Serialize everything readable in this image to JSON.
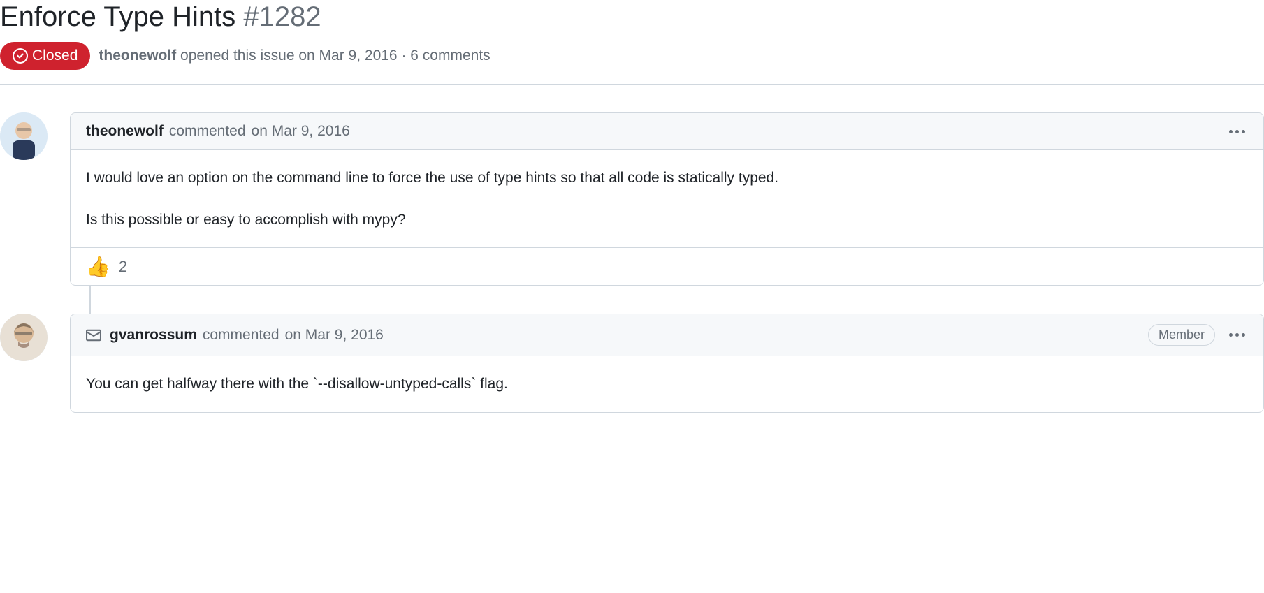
{
  "issue": {
    "title": "Enforce Type Hints",
    "number": "#1282",
    "status": "Closed",
    "author": "theonewolf",
    "opened_text": "opened this issue",
    "opened_date": "on Mar 9, 2016",
    "separator": "·",
    "comment_count": "6 comments"
  },
  "comments": [
    {
      "author": "theonewolf",
      "action": "commented",
      "date": "on Mar 9, 2016",
      "via_email": false,
      "badge": null,
      "body_p1": "I would love an option on the command line to force the use of type hints so that all code is statically typed.",
      "body_p2": "Is this possible or easy to accomplish with mypy?",
      "reaction_emoji": "👍",
      "reaction_count": "2"
    },
    {
      "author": "gvanrossum",
      "action": "commented",
      "date": "on Mar 9, 2016",
      "via_email": true,
      "badge": "Member",
      "body_p1": "You can get halfway there with the `--disallow-untyped-calls` flag."
    }
  ]
}
